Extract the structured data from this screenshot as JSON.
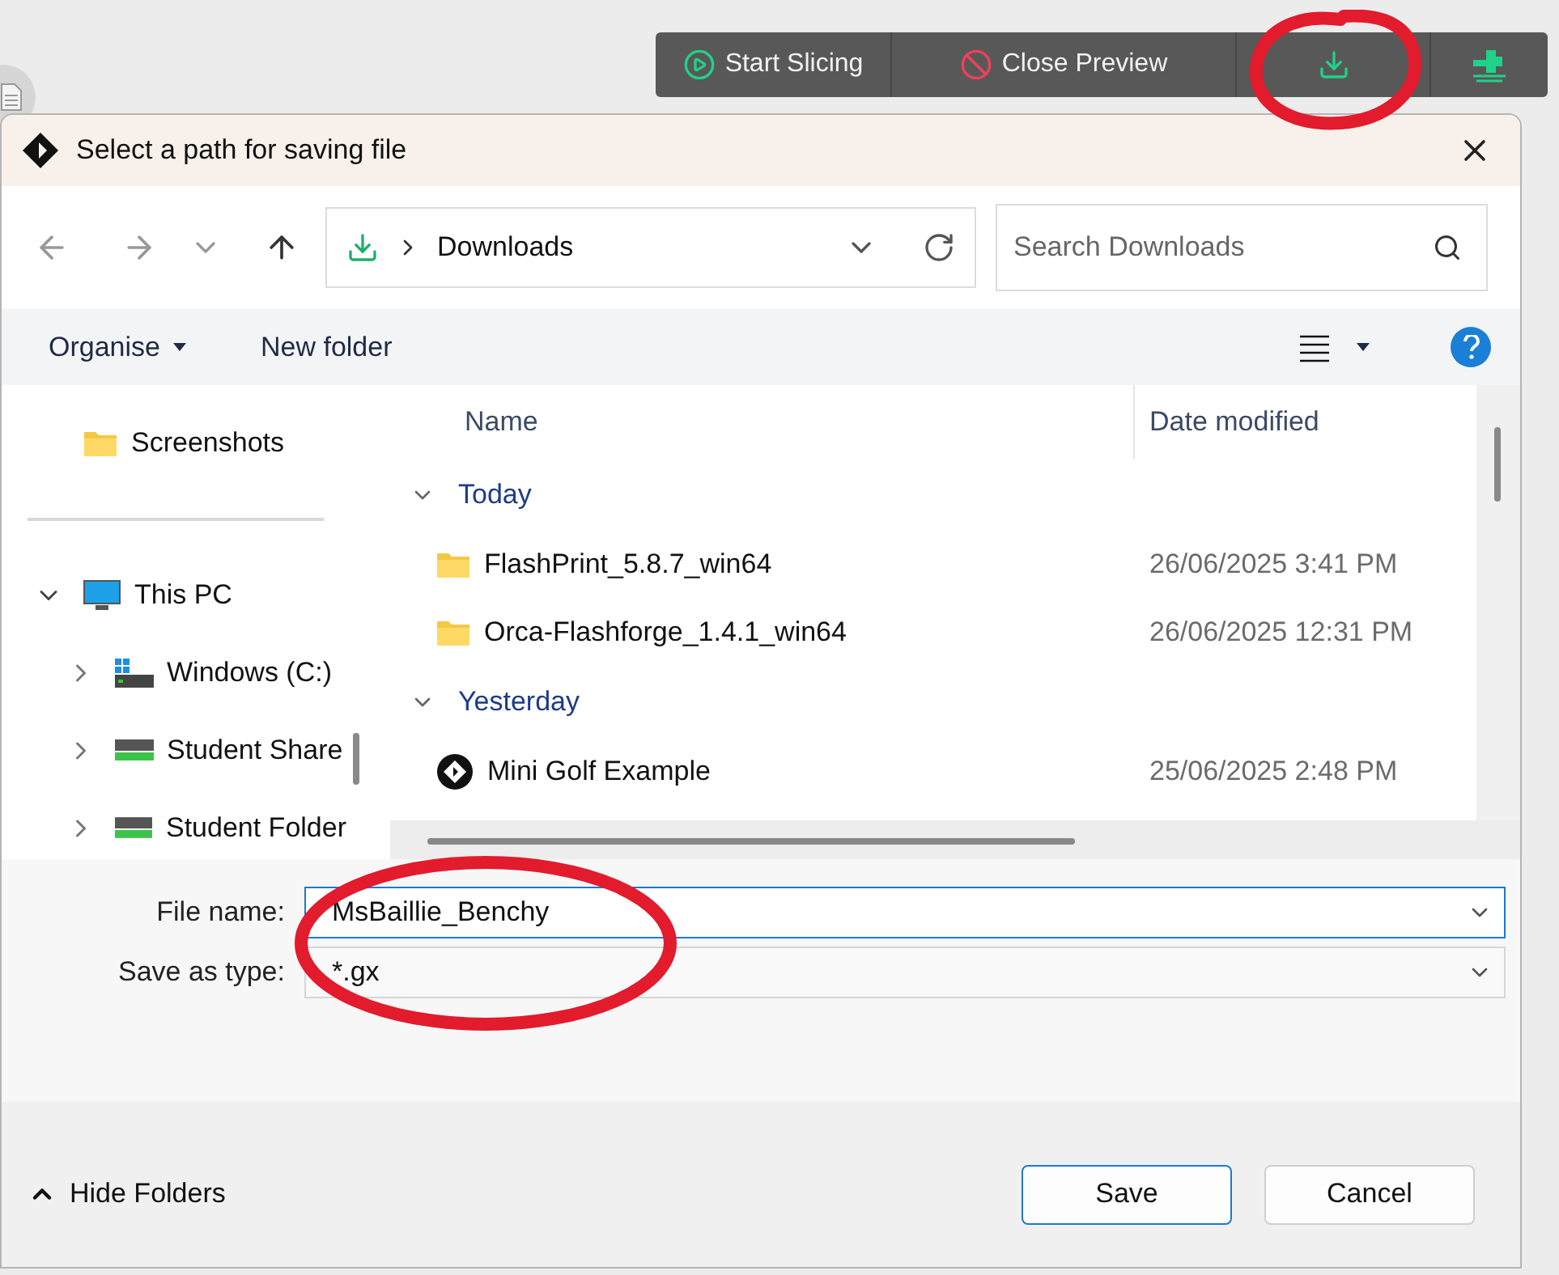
{
  "toolbar": {
    "buttons": [
      {
        "kind": "play",
        "label": "Start Slicing"
      },
      {
        "kind": "stop",
        "label": "Close Preview"
      },
      {
        "kind": "download"
      },
      {
        "kind": "plug"
      }
    ]
  },
  "dialog": {
    "title": "Select a path for saving file",
    "address": {
      "path": "Downloads",
      "search_placeholder": "Search Downloads"
    },
    "commands": {
      "organise": "Organise",
      "new_folder": "New folder"
    },
    "nav": [
      {
        "kind": "folder",
        "label": "Screenshots"
      },
      {
        "kind": "pc",
        "label": "This PC",
        "expanded": true,
        "children": [
          {
            "kind": "system-drive",
            "label": "Windows (C:)",
            "expanded": false
          },
          {
            "kind": "network-drive",
            "label": "Student Share",
            "expanded": false
          },
          {
            "kind": "network-drive",
            "label": "Student Folder",
            "expanded": false
          }
        ]
      }
    ],
    "columns": [
      "Name",
      "Date modified"
    ],
    "groups": [
      {
        "label": "Today",
        "expanded": true,
        "items": [
          {
            "kind": "folder",
            "name": "FlashPrint_5.8.7_win64",
            "date": "26/06/2025 3:41 PM"
          },
          {
            "kind": "folder",
            "name": "Orca-Flashforge_1.4.1_win64",
            "date": "26/06/2025 12:31 PM"
          }
        ]
      },
      {
        "label": "Yesterday",
        "expanded": true,
        "items": [
          {
            "kind": "app-file",
            "name": "Mini Golf Example",
            "date": "25/06/2025 2:48 PM"
          }
        ]
      }
    ],
    "fields": [
      {
        "label": "File name:",
        "value": "MsBaillie_Benchy",
        "focused": true
      },
      {
        "label": "Save as type:",
        "value": "*.gx",
        "focused": false
      }
    ],
    "hide_folders": "Hide Folders",
    "buttons": [
      {
        "label": "Save",
        "default": true
      },
      {
        "label": "Cancel",
        "default": false
      }
    ]
  }
}
